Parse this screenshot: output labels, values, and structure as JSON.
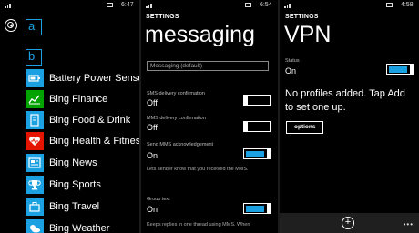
{
  "colors": {
    "accent": "#1ba1e2",
    "tile_red": "#e51400"
  },
  "screen1": {
    "time": "6:47",
    "letters": [
      "a",
      "b"
    ],
    "apps": [
      {
        "label": "Battery Power Sense",
        "icon": "battery-icon",
        "tile_color": "#1ba1e2"
      },
      {
        "label": "Bing Finance",
        "icon": "finance-chart-icon",
        "tile_color": "#00a300"
      },
      {
        "label": "Bing Food & Drink",
        "icon": "food-drink-icon",
        "tile_color": "#1ba1e2"
      },
      {
        "label": "Bing Health & Fitness",
        "icon": "heart-icon",
        "tile_color": "#e51400"
      },
      {
        "label": "Bing News",
        "icon": "news-icon",
        "tile_color": "#1ba1e2"
      },
      {
        "label": "Bing Sports",
        "icon": "trophy-icon",
        "tile_color": "#1ba1e2"
      },
      {
        "label": "Bing Travel",
        "icon": "travel-icon",
        "tile_color": "#1ba1e2"
      },
      {
        "label": "Bing Weather",
        "icon": "weather-icon",
        "tile_color": "#1ba1e2"
      }
    ]
  },
  "screen2": {
    "time": "6:54",
    "header": "SETTINGS",
    "title": "messaging",
    "textbox_value": "Messaging (default)",
    "sms_confirm_label": "SMS delivery confirmation",
    "sms_confirm_value": "Off",
    "mms_confirm_label": "MMS delivery confirmation",
    "mms_confirm_value": "Off",
    "mms_ack_label": "Send MMS acknowledgement",
    "mms_ack_value": "On",
    "mms_ack_desc": "Lets sender know that you received the MMS.",
    "group_text_label": "Group text",
    "group_text_value": "On",
    "group_text_desc": "Keeps replies in one thread using MMS. When"
  },
  "screen3": {
    "time": "4:58",
    "header": "SETTINGS",
    "title": "VPN",
    "status_label": "Status",
    "status_value": "On",
    "message_line1": "No profiles added. Tap Add",
    "message_line2": "to set one up.",
    "options_label": "options",
    "add_symbol": "+",
    "more_dots": "•••"
  }
}
